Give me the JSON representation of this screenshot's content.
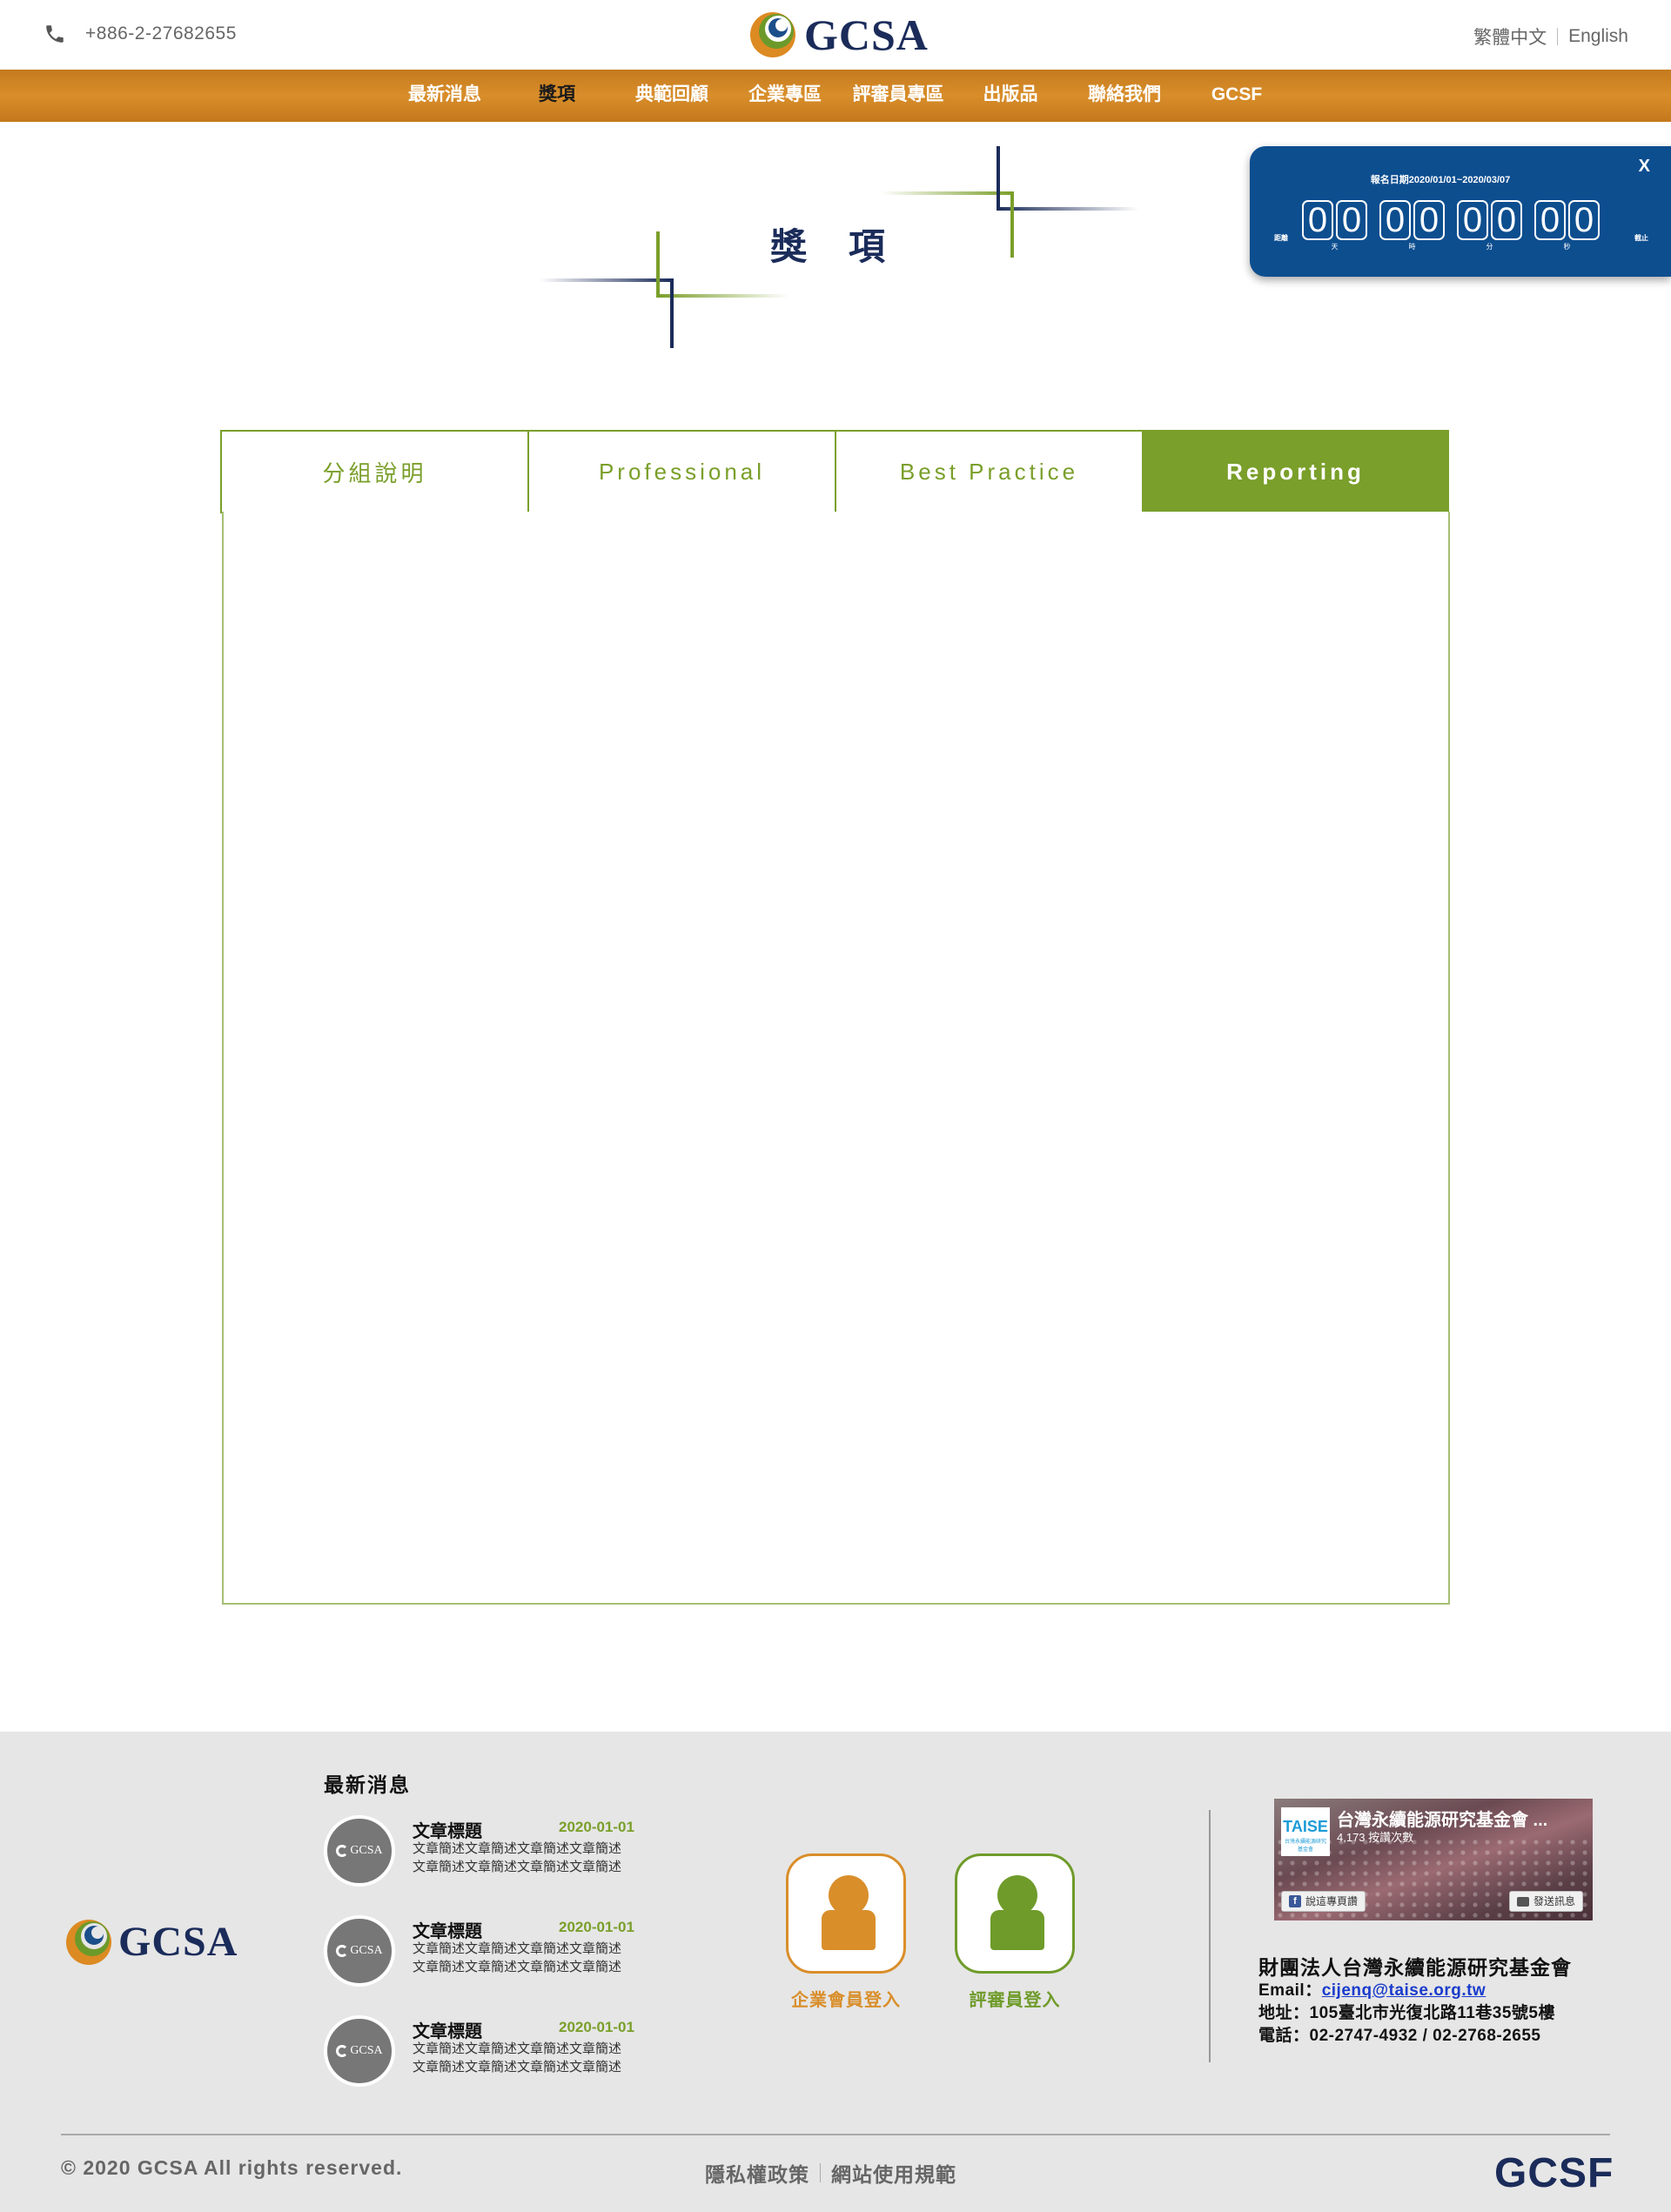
{
  "header": {
    "phone": "+886-2-27682655",
    "logo_text": "GCSA",
    "lang": {
      "zh": "繁體中文",
      "en": "English"
    }
  },
  "nav": {
    "items": [
      "最新消息",
      "獎項",
      "典範回顧",
      "企業專區",
      "評審員專區",
      "出版品",
      "聯絡我們",
      "GCSF"
    ],
    "active": "獎項"
  },
  "page": {
    "title": "獎 項"
  },
  "countdown": {
    "close": "X",
    "title": "報名日期2020/01/01~2020/03/07",
    "left_label": "距離",
    "right_label": "截止",
    "groups": [
      {
        "digits": [
          "0",
          "0"
        ],
        "unit": "天"
      },
      {
        "digits": [
          "0",
          "0"
        ],
        "unit": "時"
      },
      {
        "digits": [
          "0",
          "0"
        ],
        "unit": "分"
      },
      {
        "digits": [
          "0",
          "0"
        ],
        "unit": "秒"
      }
    ]
  },
  "tabs": {
    "items": [
      "分組說明",
      "Professional",
      "Best Practice",
      "Reporting"
    ],
    "active": "Reporting"
  },
  "footer": {
    "logo_text": "GCSA",
    "news_heading": "最新消息",
    "news": [
      {
        "thumb": "GCSA",
        "title": "文章標題",
        "date": "2020-01-01",
        "desc": [
          "文章簡述文章簡述文章簡述文章簡述",
          "文章簡述文章簡述文章簡述文章簡述"
        ]
      },
      {
        "thumb": "GCSA",
        "title": "文章標題",
        "date": "2020-01-01",
        "desc": [
          "文章簡述文章簡述文章簡述文章簡述",
          "文章簡述文章簡述文章簡述文章簡述"
        ]
      },
      {
        "thumb": "GCSA",
        "title": "文章標題",
        "date": "2020-01-01",
        "desc": [
          "文章簡述文章簡述文章簡述文章簡述",
          "文章簡述文章簡述文章簡述文章簡述"
        ]
      }
    ],
    "login": {
      "member_label": "企業會員登入",
      "judge_label": "評審員登入",
      "member_color": "#d98e2a",
      "judge_color": "#6f9b2a"
    },
    "facebook": {
      "logo_text": "TAISE",
      "logo_sub": "台灣永續能源研究基金會",
      "page_name": "台灣永續能源研究基金會 ...",
      "likes": "4,173 按讚次數",
      "like_button": "說這專頁讚",
      "message_button": "發送訊息"
    },
    "org": {
      "name": "財團法人台灣永續能源研究基金會",
      "email_label": "Email：",
      "email": "cijenq@taise.org.tw",
      "address": "地址：105臺北市光復北路11巷35號5樓",
      "phone": "電話：02-2747-4932 / 02-2768-2655"
    },
    "copyright": "© 2020 GCSA All rights reserved.",
    "policy": {
      "privacy": "隱私權政策",
      "terms": "網站使用規範"
    },
    "brand": "GCSF"
  },
  "colors": {
    "nav_bg": "#d98e2a",
    "brand_navy": "#1b2c5a",
    "accent_green": "#7a9f2a",
    "countdown_bg": "#0d4e8f",
    "footer_bg": "#e6e6e6"
  }
}
